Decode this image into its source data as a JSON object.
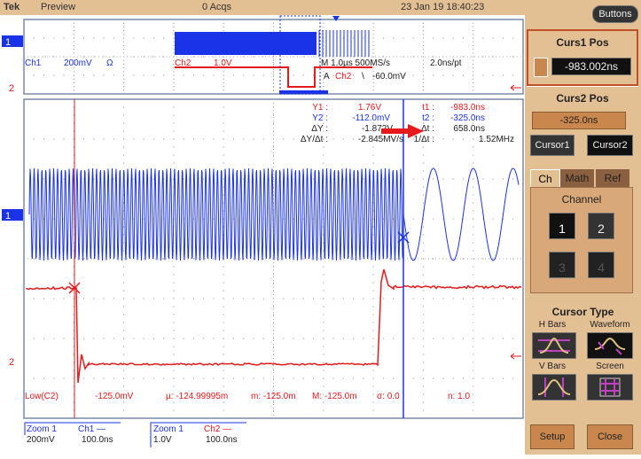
{
  "topbar": {
    "brand": "Tek",
    "mode": "Preview",
    "acqs": "0 Acqs",
    "datetime": "23 Jan 19 18:40:23"
  },
  "overview": {
    "ch1_label": "Ch1",
    "ch1_scale": "200mV",
    "ch1_coupling": "Ω",
    "ch2_label": "Ch2",
    "ch2_scale": "1.0V",
    "timebase": "M 1.0µs 500MS/s",
    "trigger_prefix": "A",
    "trigger_source": "Ch2",
    "trigger_slope": "\\",
    "trigger_level": "-60.0mV",
    "resolution": "2.0ns/pt",
    "ch1_marker": "1",
    "ch2_marker": "2"
  },
  "readout": {
    "y1_label": "Y1 :",
    "y1": "1.76V",
    "y2_label": "Y2 :",
    "y2": "-112.0mV",
    "dy_label": "ΔY :",
    "dy": "-1.872V",
    "dydt_label": "ΔY/Δt :",
    "dydt": "-2.845MV/s",
    "t1_label": "t1 :",
    "t1": "-983.0ns",
    "t2_label": "t2 :",
    "t2": "-325.0ns",
    "dt_label": "Δt :",
    "dt": "658.0ns",
    "inv_label": "1/Δt :",
    "inv": "1.52MHz"
  },
  "measurement": {
    "name": "Low(C2)",
    "value": "-125.0mV",
    "mean": "µ: -124.99995m",
    "min": "m: -125.0m",
    "max": "M: -125.0m",
    "sigma": "σ: 0.0",
    "n": "n: 1.0"
  },
  "zoom_labels": [
    {
      "title": "Zoom 1",
      "ch": "Ch1 —",
      "vscale": "200mV",
      "hscale": "100.0ns"
    },
    {
      "title": "Zoom 1",
      "ch": "Ch2 —",
      "vscale": "1.0V",
      "hscale": "100.0ns"
    }
  ],
  "panel": {
    "buttons": "Buttons",
    "curs1_title": "Curs1 Pos",
    "curs1_value": "-983.002ns",
    "curs2_title": "Curs2 Pos",
    "curs2_value": "-325.0ns",
    "cursor1": "Cursor1",
    "cursor2": "Cursor2",
    "tabs": [
      "Ch",
      "Math",
      "Ref"
    ],
    "channel_title": "Channel",
    "channels": [
      "1",
      "2",
      "3",
      "4"
    ],
    "cursor_type_title": "Cursor Type",
    "types": [
      "H Bars",
      "Waveform",
      "V Bars",
      "Screen"
    ],
    "setup": "Setup",
    "close": "Close"
  },
  "colors": {
    "ch1": "#1a33e6",
    "ch2": "#e61a1a",
    "panel": "#e3bf94"
  }
}
